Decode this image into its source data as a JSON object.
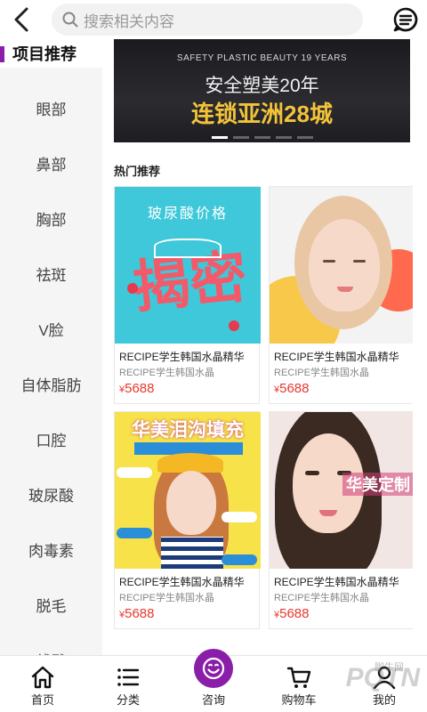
{
  "header": {
    "search_placeholder": "搜索相关内容"
  },
  "sidebar": {
    "title": "项目推荐",
    "items": [
      "眼部",
      "鼻部",
      "胸部",
      "祛斑",
      "V脸",
      "自体脂肪",
      "口腔",
      "玻尿酸",
      "肉毒素",
      "脱毛",
      "线雕"
    ]
  },
  "banner": {
    "line1": "SAFETY PLASTIC BEAUTY 19 YEARS",
    "line2": "安全塑美20年",
    "line3": "连锁亚洲28城",
    "dot_count": 5
  },
  "section": {
    "title": "热门推荐"
  },
  "products": [
    {
      "title": "RECIPE学生韩国水晶精华",
      "subtitle": "RECIPE学生韩国水晶",
      "currency": "¥",
      "price": "5688",
      "image_text": "玻尿酸价格",
      "image_big": "揭密"
    },
    {
      "title": "RECIPE学生韩国水晶精华",
      "subtitle": "RECIPE学生韩国水晶",
      "currency": "¥",
      "price": "5688"
    },
    {
      "title": "RECIPE学生韩国水晶精华",
      "subtitle": "RECIPE学生韩国水晶",
      "currency": "¥",
      "price": "5688",
      "image_text": "华美泪沟填充"
    },
    {
      "title": "RECIPE学生韩国水晶精华",
      "subtitle": "RECIPE学生韩国水晶",
      "currency": "¥",
      "price": "5688",
      "image_text": "华美定制"
    }
  ],
  "bottom_nav": {
    "home": "首页",
    "category": "分类",
    "consult": "咨询",
    "cart": "购物车",
    "mine": "我的"
  },
  "watermark": {
    "site": "脚牛网",
    "logo": "PQTN"
  },
  "colors": {
    "accent": "#8a1ea8",
    "price": "#e8382f"
  }
}
